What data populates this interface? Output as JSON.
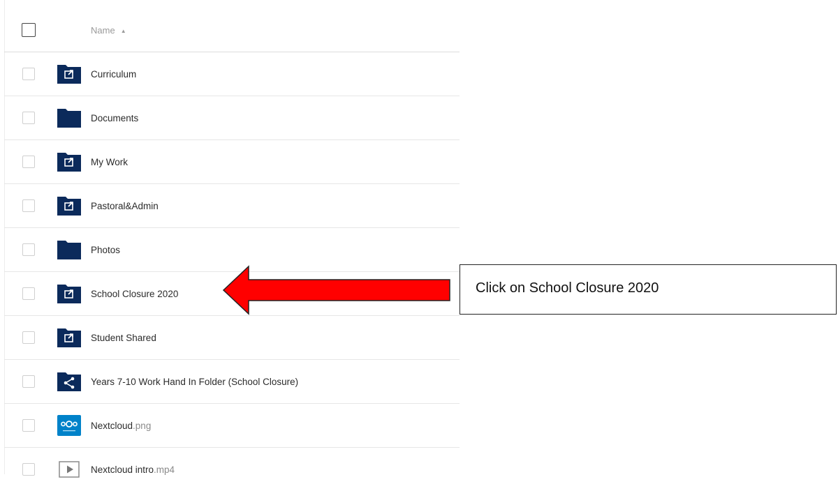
{
  "header": {
    "name_label": "Name",
    "sort_indicator": "▲"
  },
  "files": [
    {
      "name": "Curriculum",
      "ext": "",
      "icon": "shared-folder-icon"
    },
    {
      "name": "Documents",
      "ext": "",
      "icon": "folder-icon"
    },
    {
      "name": "My Work",
      "ext": "",
      "icon": "shared-folder-icon"
    },
    {
      "name": "Pastoral&Admin",
      "ext": "",
      "icon": "shared-folder-icon"
    },
    {
      "name": "Photos",
      "ext": "",
      "icon": "folder-icon"
    },
    {
      "name": "School Closure 2020",
      "ext": "",
      "icon": "shared-folder-icon"
    },
    {
      "name": "Student Shared",
      "ext": "",
      "icon": "shared-folder-icon"
    },
    {
      "name": "Years 7-10 Work Hand In Folder (School Closure)",
      "ext": "",
      "icon": "share-link-folder-icon"
    },
    {
      "name": "Nextcloud",
      "ext": ".png",
      "icon": "nextcloud-image-icon"
    },
    {
      "name": "Nextcloud intro",
      "ext": ".mp4",
      "icon": "video-file-icon"
    }
  ],
  "annotation": {
    "text": "Click on School Closure 2020",
    "arrow_color": "#ff0000"
  },
  "colors": {
    "folder": "#0b2a5b",
    "nextcloud": "#0082c9"
  }
}
